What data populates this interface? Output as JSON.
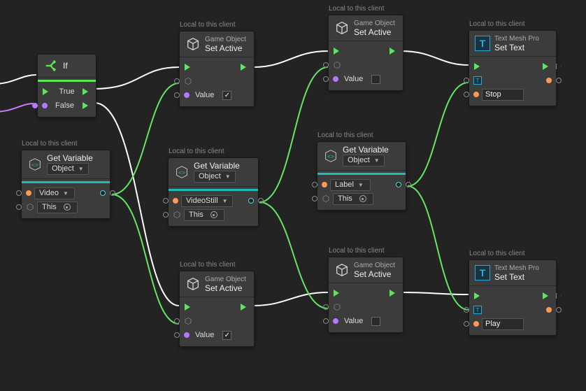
{
  "captions": {
    "local": "Local to this client"
  },
  "if_node": {
    "title": "If",
    "true_label": "True",
    "false_label": "False"
  },
  "set_active": {
    "subtitle": "Game Object",
    "title": "Set Active",
    "value_label": "Value"
  },
  "get_variable": {
    "title": "Get Variable",
    "scope": "Object",
    "video_opt": "Video",
    "this_opt": "This",
    "videostill_opt": "VideoStill",
    "label_opt": "Label"
  },
  "set_text": {
    "subtitle": "Text Mesh Pro",
    "title": "Set Text",
    "stop": "Stop",
    "play": "Play"
  }
}
